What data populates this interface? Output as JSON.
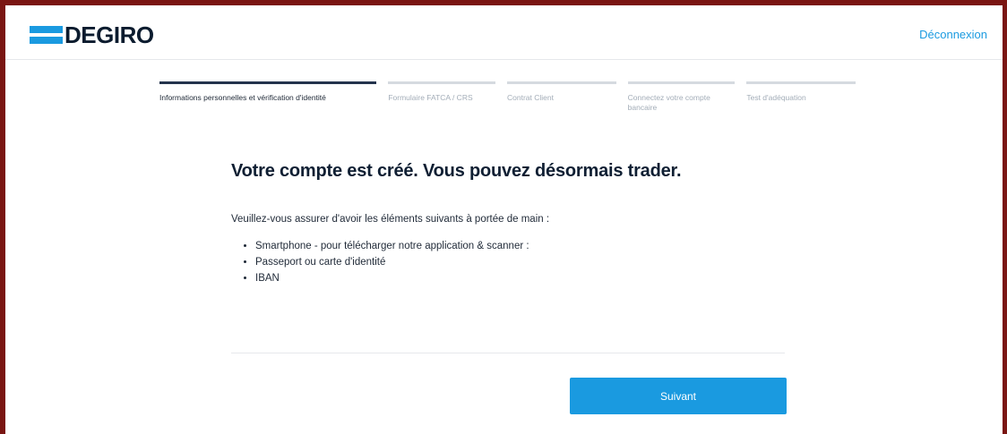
{
  "header": {
    "logo_text": "DEGIRO",
    "logout_label": "Déconnexion"
  },
  "steps": [
    {
      "label": "Informations personnelles et vérification d'identité",
      "active": true
    },
    {
      "label": "Formulaire FATCA / CRS",
      "active": false
    },
    {
      "label": "Contrat Client",
      "active": false
    },
    {
      "label": "Connectez votre compte bancaire",
      "active": false
    },
    {
      "label": "Test d'adéquation",
      "active": false
    }
  ],
  "main": {
    "title": "Votre compte est créé. Vous pouvez désormais trader.",
    "intro": "Veuillez-vous assurer d'avoir les éléments suivants à portée de main :",
    "items": [
      "Smartphone - pour télécharger notre application & scanner :",
      "Passeport ou carte d'identité",
      "IBAN"
    ]
  },
  "footer": {
    "next_label": "Suivant"
  },
  "colors": {
    "accent": "#1a9ae0",
    "active_step": "#24344d",
    "inactive_step": "#d5dae0",
    "border_frame": "#7a1512"
  }
}
